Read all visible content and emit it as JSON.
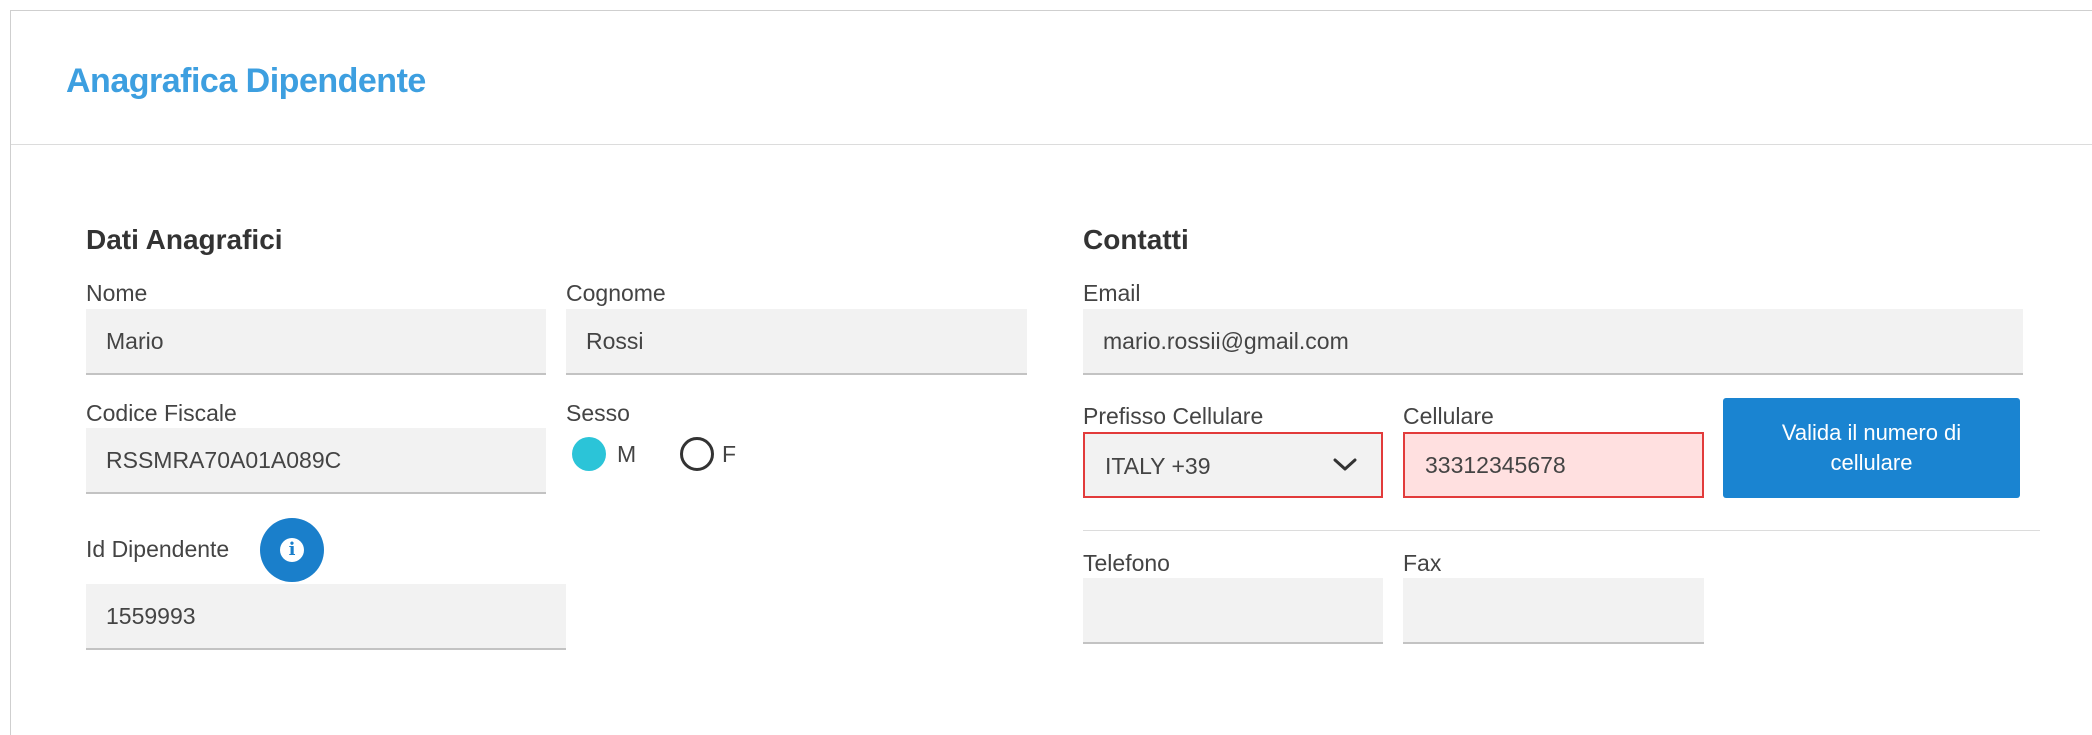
{
  "page": {
    "title": "Anagrafica Dipendente"
  },
  "dati": {
    "section_title": "Dati Anagrafici",
    "nome": {
      "label": "Nome",
      "value": "Mario"
    },
    "cognome": {
      "label": "Cognome",
      "value": "Rossi"
    },
    "codice_fiscale": {
      "label": "Codice Fiscale",
      "value": "RSSMRA70A01A089C"
    },
    "sesso": {
      "label": "Sesso",
      "options": [
        "M",
        "F"
      ],
      "selected": "M"
    },
    "id_dipendente": {
      "label": "Id Dipendente",
      "value": "1559993",
      "info_icon": "info-icon"
    }
  },
  "contatti": {
    "section_title": "Contatti",
    "email": {
      "label": "Email",
      "value": "mario.rossii@gmail.com"
    },
    "prefisso": {
      "label": "Prefisso Cellulare",
      "value": "ITALY +39"
    },
    "cellulare": {
      "label": "Cellulare",
      "value": "33312345678"
    },
    "valida_button": "Valida il numero di cellulare",
    "telefono": {
      "label": "Telefono",
      "value": ""
    },
    "fax": {
      "label": "Fax",
      "value": ""
    }
  },
  "colors": {
    "title": "#3d9fe0",
    "error_border": "#e23b3b",
    "error_bg": "#ffe0e0",
    "radio_selected": "#2bc4d8",
    "primary_button": "#1a84d1"
  }
}
